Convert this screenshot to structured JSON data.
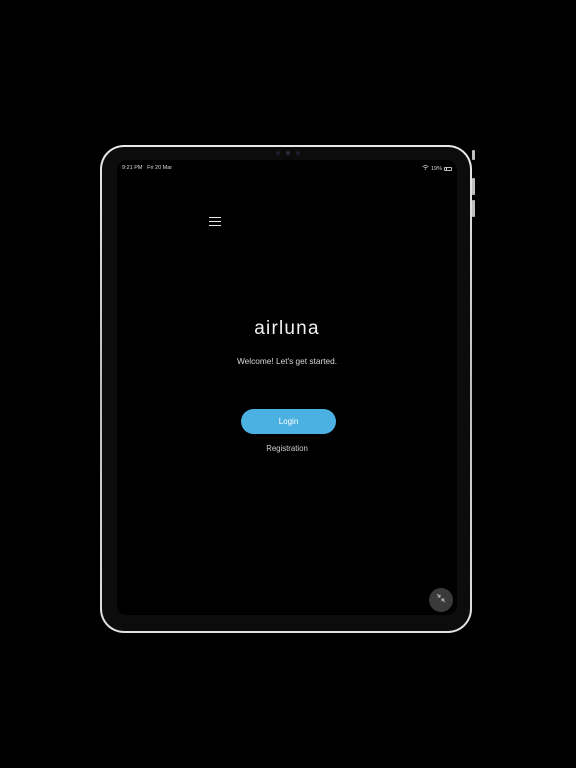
{
  "status_bar": {
    "time": "9:21 PM",
    "date": "Fri 20 Mar",
    "battery": "19%",
    "wifi_icon": "wifi-icon",
    "battery_icon": "battery-icon"
  },
  "header": {
    "menu_icon": "hamburger-menu-icon"
  },
  "main": {
    "logo_text": "airluna",
    "welcome_text": "Welcome! Let's get started.",
    "login_label": "Login",
    "registration_label": "Registration"
  },
  "floating": {
    "minimize_icon": "collapse-arrows-icon"
  },
  "colors": {
    "accent": "#4ab1e2",
    "background": "#000000"
  }
}
